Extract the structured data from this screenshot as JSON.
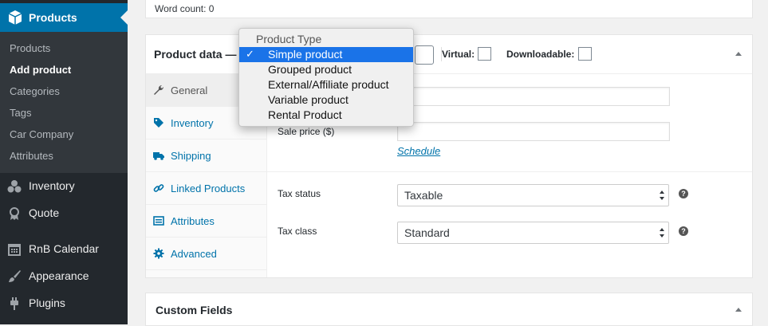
{
  "sidebar": {
    "products_label": "Products",
    "submenu": [
      "Products",
      "Add product",
      "Categories",
      "Tags",
      "Car Company",
      "Attributes"
    ],
    "items": [
      "Inventory",
      "Quote",
      "RnB Calendar",
      "Appearance",
      "Plugins"
    ]
  },
  "editor": {
    "word_count": "Word count: 0"
  },
  "product_data": {
    "title": "Product data —",
    "virtual_label": "Virtual:",
    "downloadable_label": "Downloadable:",
    "tabs": [
      "General",
      "Inventory",
      "Shipping",
      "Linked Products",
      "Attributes",
      "Advanced"
    ],
    "sale_price_label": "Sale price ($)",
    "schedule_link": "Schedule",
    "tax_status_label": "Tax status",
    "tax_status_value": "Taxable",
    "tax_class_label": "Tax class",
    "tax_class_value": "Standard",
    "help_glyph": "?"
  },
  "product_type_dropdown": {
    "header": "Product Type",
    "options": [
      "Simple product",
      "Grouped product",
      "External/Affiliate product",
      "Variable product",
      "Rental Product"
    ],
    "selected": "Simple product",
    "check_glyph": "✓"
  },
  "custom_fields": {
    "title": "Custom Fields"
  },
  "colors": {
    "sidebar_bg": "#23282d",
    "active_menu": "#0073aa",
    "link": "#0073aa",
    "dropdown_highlight": "#1a73e8"
  }
}
